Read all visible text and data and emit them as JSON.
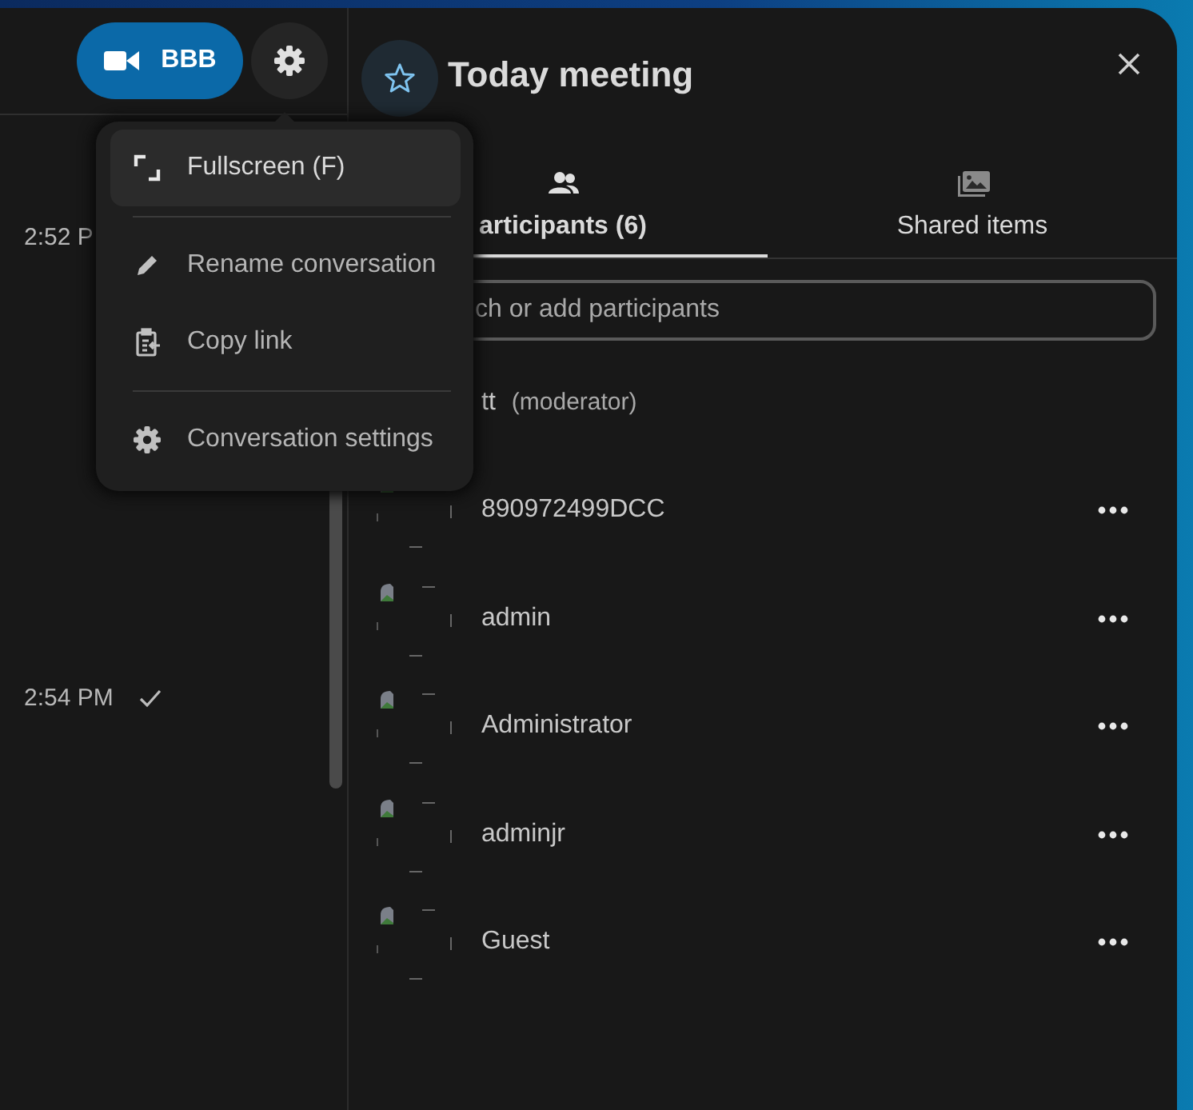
{
  "call_button": {
    "label": "BBB"
  },
  "settings_button": {
    "active": true
  },
  "messages": [
    {
      "time": "2:52 P"
    },
    {
      "time": "2:54 PM",
      "ticked": true
    }
  ],
  "menu": {
    "items": [
      {
        "kind": "fullscreen",
        "label": "Fullscreen (F)",
        "highlighted": true
      },
      {
        "kind": "divider"
      },
      {
        "kind": "rename",
        "label": "Rename conversation",
        "highlighted": false
      },
      {
        "kind": "copy",
        "label": "Copy link",
        "highlighted": false
      },
      {
        "kind": "divider"
      },
      {
        "kind": "settings",
        "label": "Conversation settings",
        "highlighted": false
      }
    ]
  },
  "sidebar": {
    "title": "Today meeting",
    "favorite": false,
    "tabs": [
      {
        "kind": "participants",
        "label": "articipants (6)",
        "selected": true
      },
      {
        "kind": "shared",
        "label": "Shared items",
        "selected": false
      }
    ],
    "search": {
      "placeholder": "ch or add participants"
    },
    "participants": [
      {
        "name": "tt",
        "role": "(moderator)",
        "avatar_shown": false,
        "actions": false
      },
      {
        "name": "890972499DCC",
        "avatar_shown": true,
        "actions": true
      },
      {
        "name": "admin",
        "avatar_shown": true,
        "actions": true
      },
      {
        "name": "Administrator",
        "avatar_shown": true,
        "actions": true
      },
      {
        "name": "adminjr",
        "avatar_shown": true,
        "actions": true
      },
      {
        "name": "Guest",
        "avatar_shown": true,
        "actions": true
      }
    ]
  }
}
